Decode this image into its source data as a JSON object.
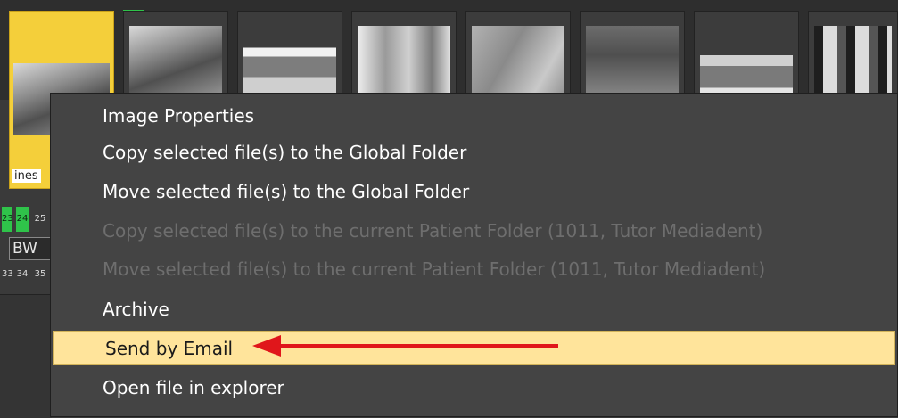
{
  "thumbnails": {
    "selected_label": "ines"
  },
  "side_panel": {
    "green_cells": [
      "23",
      "24"
    ],
    "cells_top": [
      "25"
    ],
    "bw_label": "BW",
    "cells_bottom": [
      "33",
      "34",
      "35"
    ]
  },
  "context_menu": {
    "items": [
      {
        "label": "Image Properties",
        "enabled": true
      },
      {
        "label": "Copy selected file(s) to the Global Folder",
        "enabled": true
      },
      {
        "label": "Move selected file(s) to the Global Folder",
        "enabled": true
      },
      {
        "label": "Copy selected file(s) to the current Patient Folder (1011, Tutor Mediadent)",
        "enabled": false
      },
      {
        "label": "Move selected file(s) to the current Patient Folder (1011, Tutor Mediadent)",
        "enabled": false
      },
      {
        "label": "Archive",
        "enabled": true
      },
      {
        "label": "Send by Email",
        "enabled": true,
        "highlighted": true
      },
      {
        "label": "Open file in explorer",
        "enabled": true
      }
    ]
  },
  "colors": {
    "selection": "#f4cf3a",
    "menu_highlight": "#ffe49b",
    "annotation_arrow": "#e0161b",
    "tooth_marker": "#2fc34a"
  }
}
